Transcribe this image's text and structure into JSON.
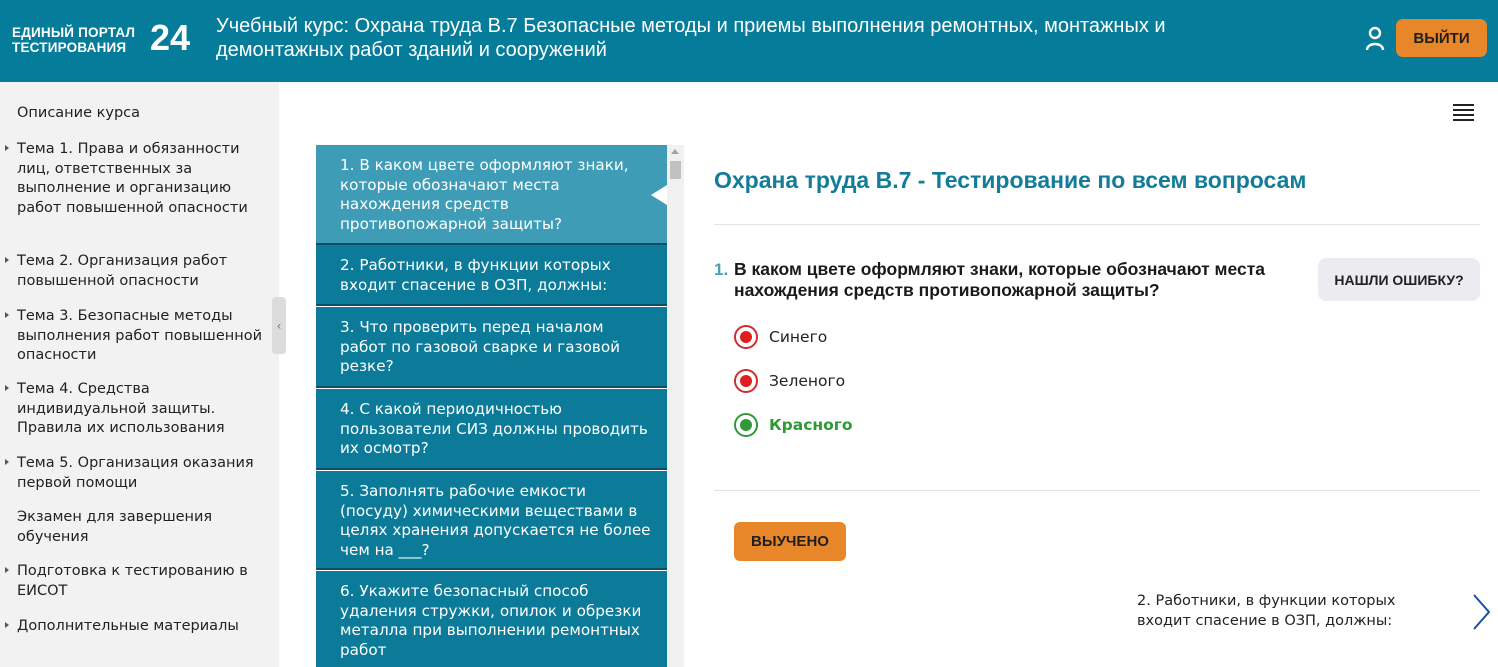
{
  "header": {
    "logo_line1": "ЕДИНЫЙ ПОРТАЛ",
    "logo_line2": "ТЕСТИРОВАНИЯ",
    "logo_number": "24",
    "course_title": "Учебный курс: Охрана труда В.7 Безопасные методы и приемы выполнения ремонтных, монтажных и демонтажных работ зданий и сооружений",
    "user_icon": "user-icon",
    "logout_label": "ВЫЙТИ"
  },
  "sidebar": {
    "items": [
      {
        "label": "Описание курса",
        "has_arrow": false
      },
      {
        "label": "Тема 1. Права и обязанности лиц, ответственных за выполнение и организацию работ повышенной опасности",
        "has_arrow": true
      },
      {
        "label": "Тема 2. Организация работ повышенной опасности",
        "has_arrow": true
      },
      {
        "label": "Тема 3. Безопасные методы выполнения работ повышенной опасности",
        "has_arrow": true
      },
      {
        "label": "Тема 4. Средства индивидуальной защиты. Правила их использования",
        "has_arrow": true
      },
      {
        "label": "Тема 5. Организация оказания первой помощи",
        "has_arrow": true
      },
      {
        "label": "Экзамен для завершения обучения",
        "has_arrow": false
      },
      {
        "label": "Подготовка к тестированию в ЕИСОТ",
        "has_arrow": true
      },
      {
        "label": "Дополнительные материалы",
        "has_arrow": true
      }
    ]
  },
  "question_list": [
    {
      "label": "1. В каком цвете оформляют знаки, которые обозначают места нахождения средств противопожарной защиты?",
      "active": true
    },
    {
      "label": "2. Работники, в функции которых входит спасение в ОЗП, должны:",
      "active": false
    },
    {
      "label": "3. Что проверить перед началом работ по газовой сварке и газовой резке?",
      "active": false
    },
    {
      "label": "4. С какой периодичностью пользователи СИЗ должны проводить их осмотр?",
      "active": false
    },
    {
      "label": "5. Заполнять рабочие емкости (посуду) химическими веществами в целях хранения допускается не более чем на ___?",
      "active": false
    },
    {
      "label": "6. Укажите безопасный способ удаления стружки, опилок и обрезки металла при выполнении ремонтных работ",
      "active": false
    }
  ],
  "main": {
    "title": "Охрана труда В.7 - Тестирование по всем вопросам",
    "question_number": "1.",
    "question_text": "В каком цвете оформляют знаки, которые обозначают места нахождения средств противопожарной защиты?",
    "report_label": "НАШЛИ ОШИБКУ?",
    "answers": [
      {
        "label": "Синего",
        "correct": false
      },
      {
        "label": "Зеленого",
        "correct": false
      },
      {
        "label": "Красного",
        "correct": true
      }
    ],
    "learned_label": "ВЫУЧЕНО",
    "next_question": "2. Работники, в функции которых входит спасение в ОЗП, должны:"
  },
  "colors": {
    "header_bg": "#057c99",
    "accent_orange": "#e8862a",
    "active_question": "#3f9cb6",
    "question_bg": "#0b7b99",
    "correct_green": "#2f9a3a",
    "wrong_red": "#e01e1e",
    "title_teal": "#137d99"
  }
}
